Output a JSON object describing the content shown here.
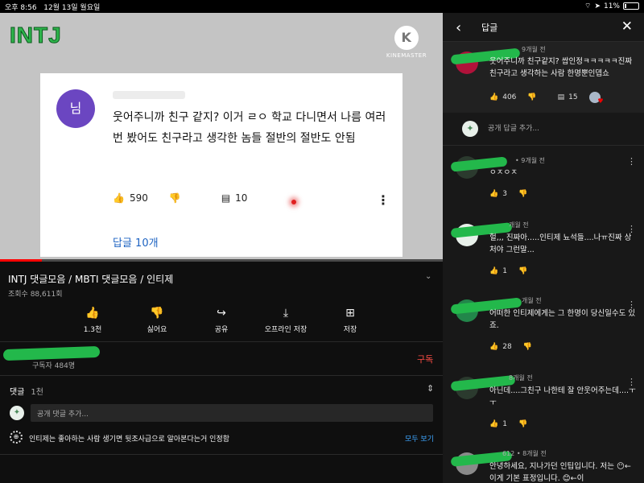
{
  "statusbar": {
    "time": "오후 8:56",
    "date": "12월 13일 월요일",
    "battery": "11%"
  },
  "video": {
    "logo": "INTJ",
    "watermark": "KINEMASTER",
    "watermark_glyph": "K",
    "card": {
      "avatar_text": "님",
      "text": "웃어주니까 친구 같지? 이거 ㄹㅇ 학교 다니면서 나름 여러번 봤어도 친구라고 생각한 놈들 절반의 절반도 안됨",
      "likes": "590",
      "replies": "10",
      "replies_link": "답글 10개"
    },
    "progress": 0.095
  },
  "info": {
    "title": "INTJ 댓글모음 / MBTI 댓글모음 / 인티제",
    "views": "조회수 88,611회",
    "actions": [
      {
        "icon": "👍",
        "label": "1.3천",
        "name": "like-button"
      },
      {
        "icon": "👎",
        "label": "싫어요",
        "name": "dislike-button"
      },
      {
        "icon": "↪",
        "label": "공유",
        "name": "share-button"
      },
      {
        "icon": "⤓",
        "label": "오프라인 저장",
        "name": "download-button"
      },
      {
        "icon": "⊞",
        "label": "저장",
        "name": "save-button"
      }
    ],
    "subscribers": "구독자 484명",
    "subscribe": "구독"
  },
  "comments": {
    "title": "댓글",
    "count": "1천",
    "input_placeholder": "공개 댓글 추가...",
    "notice": "인티제는 좋아하는 사람 생기면 뒷조사급으로 알아본다는거 인정함",
    "notice_more": "모두 보기"
  },
  "replies_panel": {
    "title": "답글",
    "top": {
      "meta": "9개월 전",
      "text": "웃어주니까 친구같지? 쌉인정ㅋㅋㅋㅋㅋ진짜 친구라고 생각하는 사람 한명뿐인뎁쇼",
      "likes": "406",
      "replies": "15"
    },
    "add_reply": "공개 답글 추가...",
    "items": [
      {
        "meta": "• 9개월 전",
        "text": "ㅇㅈㅇㅈ",
        "likes": "3"
      },
      {
        "meta": "개월 전",
        "text": "헐,,, 진짜아.....인티제 뇨석들....나ㅠ진짜 상처야 그런말...",
        "likes": "1"
      },
      {
        "meta": "개월 전",
        "text": "어떠한 인티제에게는 그 한명이 당신일수도 있죠.",
        "likes": "28"
      },
      {
        "meta": "8개월 전",
        "text": "아닌데....그친구 나한테 잘 안웃어주는데....ㅜㅜ",
        "likes": "1"
      },
      {
        "meta": "612 • 8개월 전",
        "text": "안녕하세요, 지나가던 인팁입니다. 저는 😶←이게 기본 표정입니다. 😊←이",
        "likes": ""
      }
    ]
  }
}
